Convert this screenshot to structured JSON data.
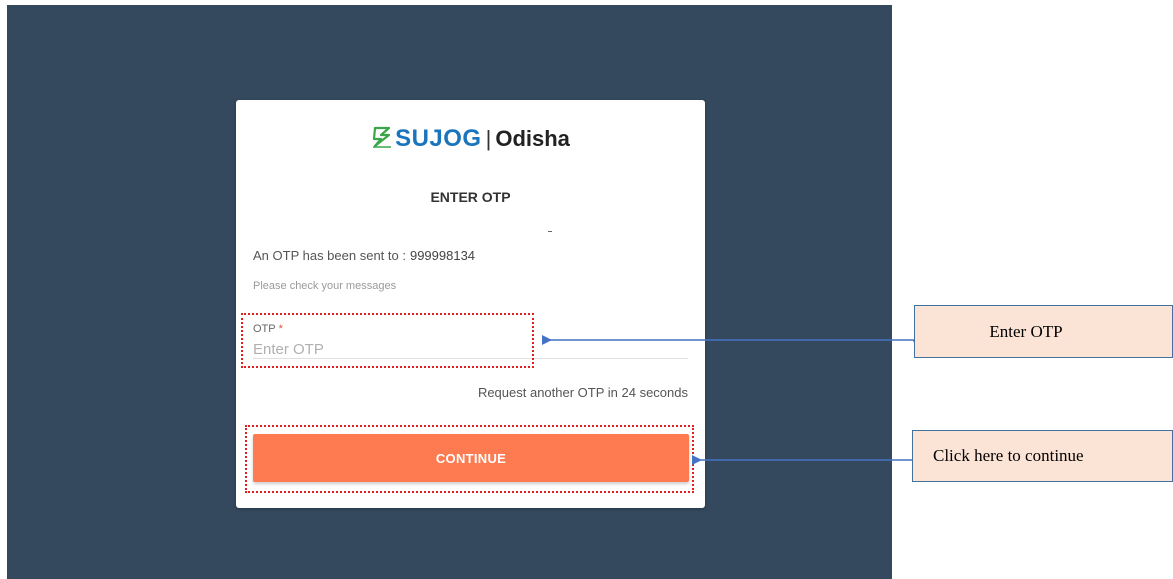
{
  "brand": {
    "name": "SUJOG",
    "separator": "|",
    "region": "Odisha",
    "color": "#1b75bc"
  },
  "otp_screen": {
    "title": "ENTER OTP",
    "sent_prefix": "An OTP has been sent to :",
    "phone": "999998134",
    "hint": "Please check your messages",
    "otp_label": "OTP",
    "otp_required_mark": "*",
    "otp_placeholder": "Enter OTP",
    "otp_value": "",
    "resend_text": "Request another OTP in 24 seconds",
    "continue_label": "CONTINUE"
  },
  "annotations": {
    "otp_callout": "Enter OTP",
    "continue_callout": "Click here to continue"
  },
  "colors": {
    "background": "#34495e",
    "primary_button": "#fe7a51",
    "callout_fill": "#fbe4d5",
    "callout_border": "#41719c",
    "highlight_border": "#e02020",
    "arrow": "#4472c4"
  },
  "icons": {
    "logo": "sujog-logo-icon"
  }
}
